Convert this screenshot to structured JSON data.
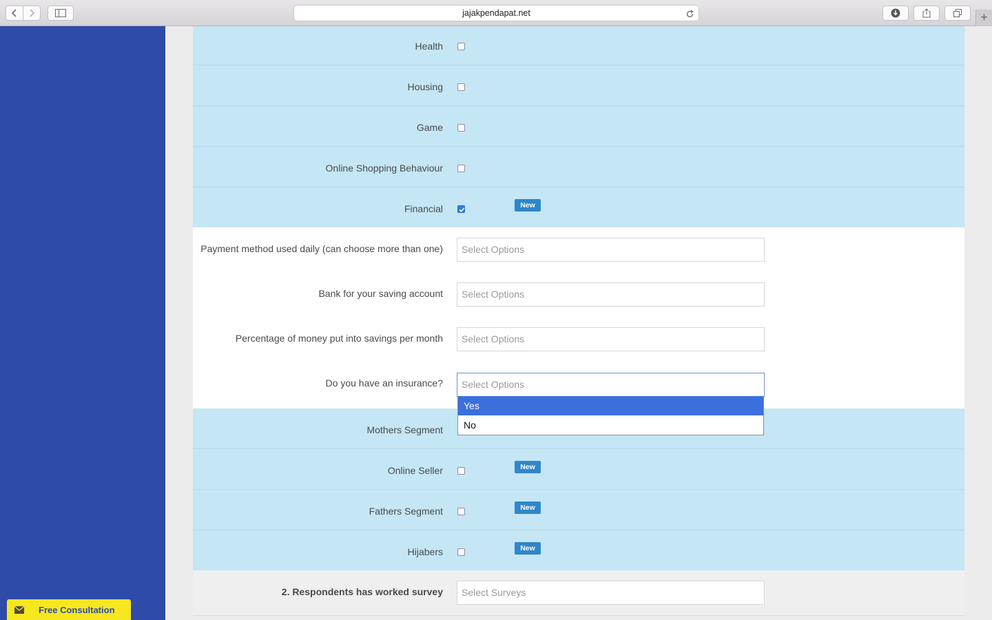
{
  "browser": {
    "url": "jajakpendapat.net",
    "new_tab_glyph": "+"
  },
  "sidebar": {
    "cta_label": "Free Consultation",
    "cta_icon": "envelope-icon"
  },
  "segments_top": [
    {
      "label": "Health",
      "checked": false,
      "badge": ""
    },
    {
      "label": "Housing",
      "checked": false,
      "badge": ""
    },
    {
      "label": "Game",
      "checked": false,
      "badge": ""
    },
    {
      "label": "Online Shopping Behaviour",
      "checked": false,
      "badge": ""
    },
    {
      "label": "Financial",
      "checked": true,
      "badge": "New"
    }
  ],
  "financial_questions": [
    {
      "label": "Payment method used daily (can choose more than one)",
      "placeholder": "Select Options"
    },
    {
      "label": "Bank for your saving account",
      "placeholder": "Select Options"
    },
    {
      "label": "Percentage of money put into savings per month",
      "placeholder": "Select Options"
    },
    {
      "label": "Do you have an insurance?",
      "placeholder": "Select Options"
    }
  ],
  "insurance_dropdown": {
    "options": [
      "Yes",
      "No"
    ],
    "highlighted": "Yes"
  },
  "segments_bottom": [
    {
      "label": "Mothers Segment",
      "checked": false,
      "badge": ""
    },
    {
      "label": "Online Seller",
      "checked": false,
      "badge": "New"
    },
    {
      "label": "Fathers Segment",
      "checked": false,
      "badge": "New"
    },
    {
      "label": "Hijabers",
      "checked": false,
      "badge": "New"
    }
  ],
  "worked_survey": {
    "label": "2. Respondents has worked survey",
    "placeholder": "Select Surveys"
  },
  "colors": {
    "sidebar": "#2e4ba9",
    "row_blue": "#c4e6f5",
    "badge": "#2f86c9",
    "cta": "#f6e71f",
    "highlight": "#3b6fdc"
  }
}
